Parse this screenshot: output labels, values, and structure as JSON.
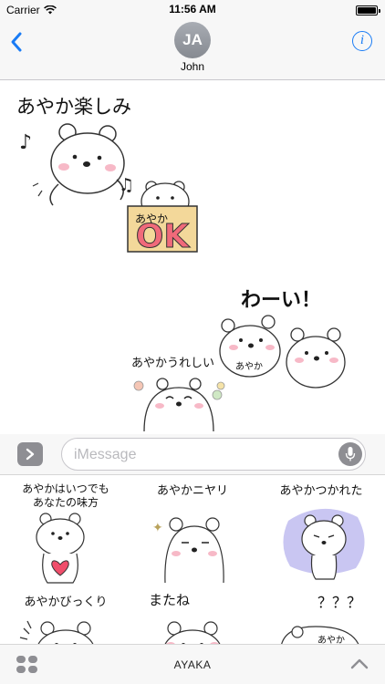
{
  "status_bar": {
    "carrier": "Carrier",
    "time": "11:56 AM"
  },
  "nav": {
    "avatar_initials": "JA",
    "contact_name": "John",
    "info_glyph": "i"
  },
  "conversation": {
    "stickers": [
      {
        "text": "あやか楽しみ"
      },
      {
        "text": "あやか",
        "big_text": "OK"
      },
      {
        "text": "わーい！",
        "tag": "あやか"
      },
      {
        "text": "あやかうれしい"
      }
    ]
  },
  "input_bar": {
    "placeholder": "iMessage"
  },
  "drawer": {
    "items": [
      {
        "label_line1": "あやかはいつでも",
        "label_line2": "あなたの味方"
      },
      {
        "label_line1": "あやかニヤリ"
      },
      {
        "label_line1": "あやかつかれた"
      },
      {
        "label_line1": "あやかびっくり"
      },
      {
        "label_line1": "またね"
      },
      {
        "label_line1": "？？？",
        "tag": "あやか"
      }
    ]
  },
  "bottom_bar": {
    "pack_name": "AYAKA"
  },
  "colors": {
    "ios_blue": "#1a7cf5",
    "gray_control": "#8e8e93",
    "bar_background": "#f7f7f7",
    "ok_sign": "#f3d89a",
    "ok_letters": "#f06a7a",
    "blush": "#f7b9c7",
    "heart": "#f04e6b",
    "purple_cloud": "#c9c6f2"
  },
  "icons": [
    "wifi-icon",
    "battery-icon",
    "back-chevron-icon",
    "info-icon",
    "apps-chevron-icon",
    "mic-icon",
    "app-drawer-icon",
    "expand-chevron-icon"
  ]
}
